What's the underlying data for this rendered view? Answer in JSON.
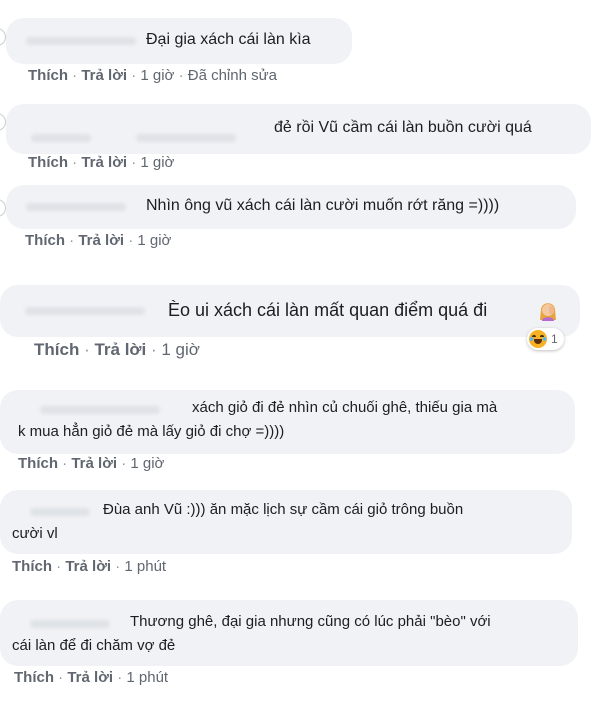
{
  "comments": [
    {
      "text": "Đại gia xách cái làn kìa",
      "like": "Thích",
      "reply": "Trả lời",
      "time": "1 giờ",
      "edited": "Đã chỉnh sửa"
    },
    {
      "text": "đẻ rồi Vũ cầm cái làn buồn cười quá",
      "like": "Thích",
      "reply": "Trả lời",
      "time": "1 giờ"
    },
    {
      "text": "Nhìn ông vũ xách cái làn cười muốn rớt răng =))))",
      "like": "Thích",
      "reply": "Trả lời",
      "time": "1 giờ"
    },
    {
      "text": "Èo ui xách cái làn mất quan điểm quá đi",
      "like": "Thích",
      "reply": "Trả lời",
      "time": "1 giờ",
      "reaction_count": "1",
      "reaction_icon": "haha-reaction-icon",
      "emoji_icon": "woman-facepalming-emoji-icon"
    },
    {
      "line1": "xách giỏ đi đẻ nhìn củ chuối ghê, thiếu gia mà",
      "line2": "k mua hẳn giỏ đẻ mà lấy giỏ đi chợ =))))",
      "like": "Thích",
      "reply": "Trả lời",
      "time": "1 giờ"
    },
    {
      "line1": "Đùa anh Vũ :))) ăn mặc lịch sự cầm cái giỏ trông buồn",
      "line2": "cười vl",
      "like": "Thích",
      "reply": "Trả lời",
      "time": "1 phút"
    },
    {
      "line1": "Thương ghê, đại gia nhưng cũng có lúc phải \"bèo\" với",
      "line2": "cái làn để đi chăm vợ đẻ",
      "like": "Thích",
      "reply": "Trả lời",
      "time": "1 phút"
    }
  ],
  "separator": "·",
  "colors": {
    "bubble": "#f0f2f5",
    "text": "#1c1e21",
    "action": "#606770",
    "reaction_yellow": "#f7b125"
  }
}
